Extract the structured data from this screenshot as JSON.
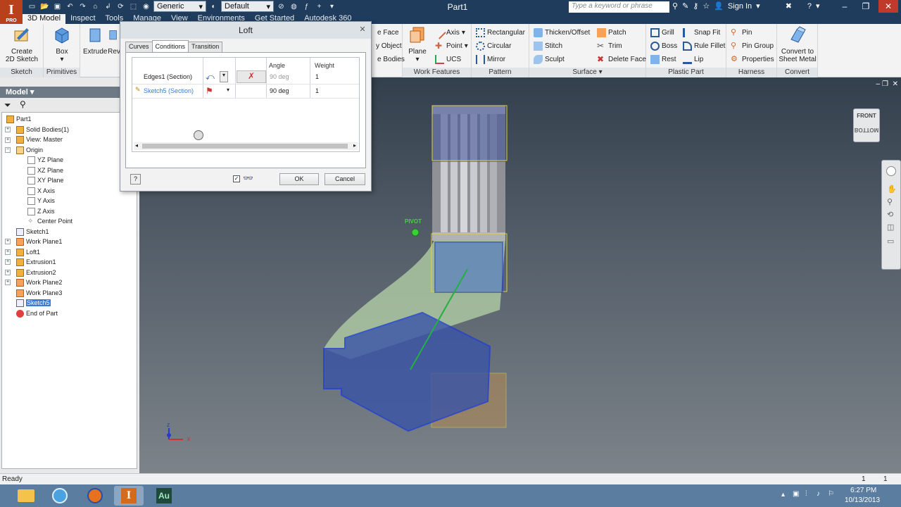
{
  "app": {
    "icon_letter": "I",
    "icon_sub": "PRO",
    "title": "Part1"
  },
  "qat": {
    "material": "Generic",
    "appearance": "Default"
  },
  "search": {
    "placeholder": "Type a keyword or phrase"
  },
  "account": {
    "sign_in": "Sign In"
  },
  "tabs": [
    "3D Model",
    "Inspect",
    "Tools",
    "Manage",
    "View",
    "Environments",
    "Get Started",
    "Autodesk 360"
  ],
  "ribbon": {
    "sketch": {
      "label": "Sketch",
      "create": "Create\n2D Sketch",
      "create_l1": "Create",
      "create_l2": "2D Sketch"
    },
    "primitives": {
      "label": "Primitives",
      "box": "Box"
    },
    "create": {
      "extrude": "Extrude",
      "revolve": "Rev"
    },
    "modify": {
      "face": "e Face",
      "object": "y Object",
      "bodies": "e Bodies"
    },
    "work": {
      "label": "Work Features",
      "plane": "Plane",
      "axis": "Axis",
      "point": "Point",
      "ucs": "UCS"
    },
    "pattern": {
      "label": "Pattern",
      "rectangular": "Rectangular",
      "circular": "Circular",
      "mirror": "Mirror"
    },
    "surface": {
      "label": "Surface",
      "thicken": "Thicken/Offset",
      "stitch": "Stitch",
      "sculpt": "Sculpt",
      "patch": "Patch",
      "trim": "Trim",
      "delete_face": "Delete Face"
    },
    "plastic": {
      "label": "Plastic Part",
      "grill": "Grill",
      "boss": "Boss",
      "rest": "Rest",
      "snap_fit": "Snap Fit",
      "rule_fillet": "Rule Fillet",
      "lip": "Lip"
    },
    "harness": {
      "label": "Harness",
      "pin": "Pin",
      "pin_group": "Pin Group",
      "properties": "Properties"
    },
    "convert": {
      "label": "Convert",
      "sheet_metal_l1": "Convert to",
      "sheet_metal_l2": "Sheet Metal"
    }
  },
  "browser": {
    "header": "Model",
    "items": [
      {
        "label": "Part1"
      },
      {
        "label": "Solid Bodies(1)"
      },
      {
        "label": "View: Master"
      },
      {
        "label": "Origin"
      },
      {
        "label": "YZ Plane"
      },
      {
        "label": "XZ Plane"
      },
      {
        "label": "XY Plane"
      },
      {
        "label": "X Axis"
      },
      {
        "label": "Y Axis"
      },
      {
        "label": "Z Axis"
      },
      {
        "label": "Center Point"
      },
      {
        "label": "Sketch1"
      },
      {
        "label": "Work Plane1"
      },
      {
        "label": "Loft1"
      },
      {
        "label": "Extrusion1"
      },
      {
        "label": "Extrusion2"
      },
      {
        "label": "Work Plane2"
      },
      {
        "label": "Work Plane3"
      },
      {
        "label": "Sketch5"
      },
      {
        "label": "End of Part"
      }
    ]
  },
  "dialog": {
    "title": "Loft",
    "tabs": [
      "Curves",
      "Conditions",
      "Transition"
    ],
    "columns": {
      "angle": "Angle",
      "weight": "Weight"
    },
    "rows": [
      {
        "name": "Edges1 (Section)",
        "angle": "90 deg",
        "weight": "1"
      },
      {
        "name": "Sketch5 (Section)",
        "angle": "90 deg",
        "weight": "1"
      }
    ],
    "ok": "OK",
    "cancel": "Cancel",
    "help": "?"
  },
  "viewport": {
    "pivot_label": "PIVOT",
    "viewcube_front": "FRONT",
    "viewcube_bottom": "BOTTOM",
    "axis_z": "z",
    "axis_x": "x"
  },
  "status": {
    "text": "Ready",
    "count1": "1",
    "count2": "1"
  },
  "taskbar": {
    "time": "6:27 PM",
    "date": "10/13/2013",
    "au_label": "Au"
  }
}
